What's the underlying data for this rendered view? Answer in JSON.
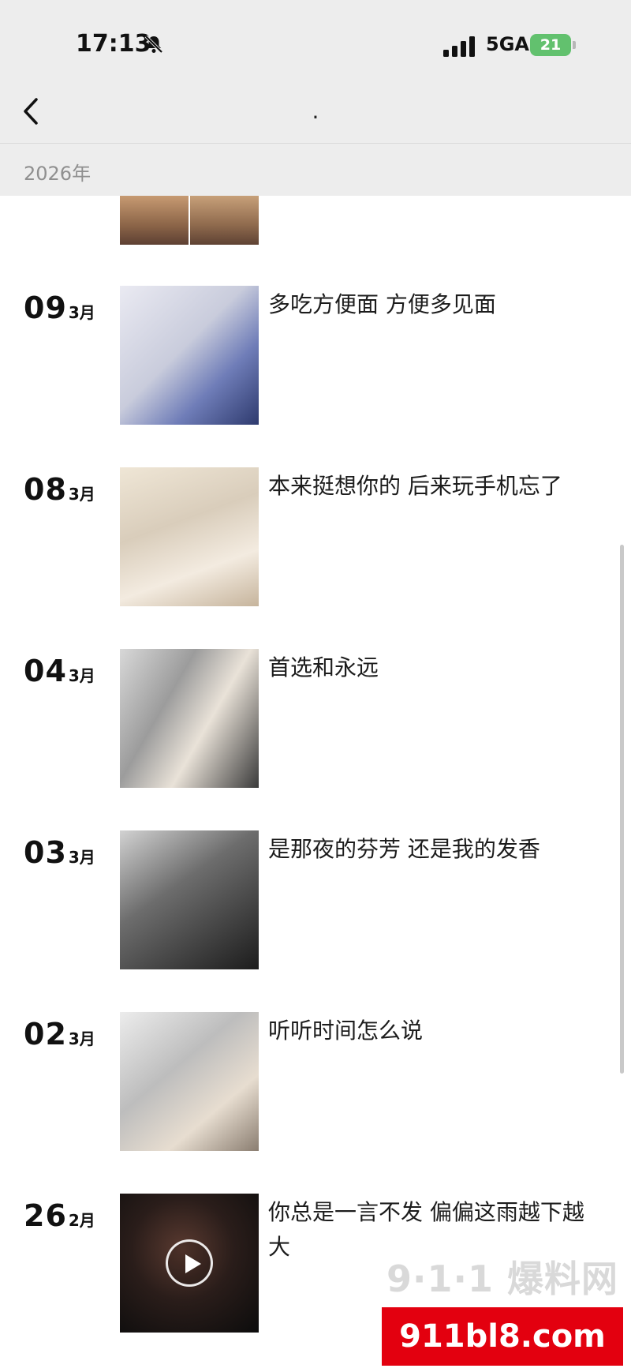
{
  "status_bar": {
    "time": "17:13",
    "network": "5GA",
    "battery": "21"
  },
  "nav": {
    "title": "."
  },
  "year_label": "2026年",
  "posts": [
    {
      "day": "09",
      "month": "3月",
      "caption": "多吃方便面 方便多见面",
      "media": "photo"
    },
    {
      "day": "08",
      "month": "3月",
      "caption": "本来挺想你的 后来玩手机忘了",
      "media": "photo"
    },
    {
      "day": "04",
      "month": "3月",
      "caption": "首选和永远",
      "media": "photo"
    },
    {
      "day": "03",
      "month": "3月",
      "caption": "是那夜的芬芳 还是我的发香",
      "media": "photo"
    },
    {
      "day": "02",
      "month": "3月",
      "caption": "听听时间怎么说",
      "media": "photo"
    },
    {
      "day": "26",
      "month": "2月",
      "caption": "你总是一言不发 偏偏这雨越下越大",
      "media": "video"
    }
  ],
  "watermark": {
    "top_text": "9·1·1 爆料网",
    "bottom_text": "911bl8.com"
  },
  "icons": {
    "back": "chevron-left-icon",
    "mute": "bell-slash-icon",
    "signal": "signal-bars-icon",
    "play": "play-icon"
  },
  "colors": {
    "header_bg": "#ededed",
    "battery": "#62c16e",
    "watermark_red": "#e3000f"
  }
}
